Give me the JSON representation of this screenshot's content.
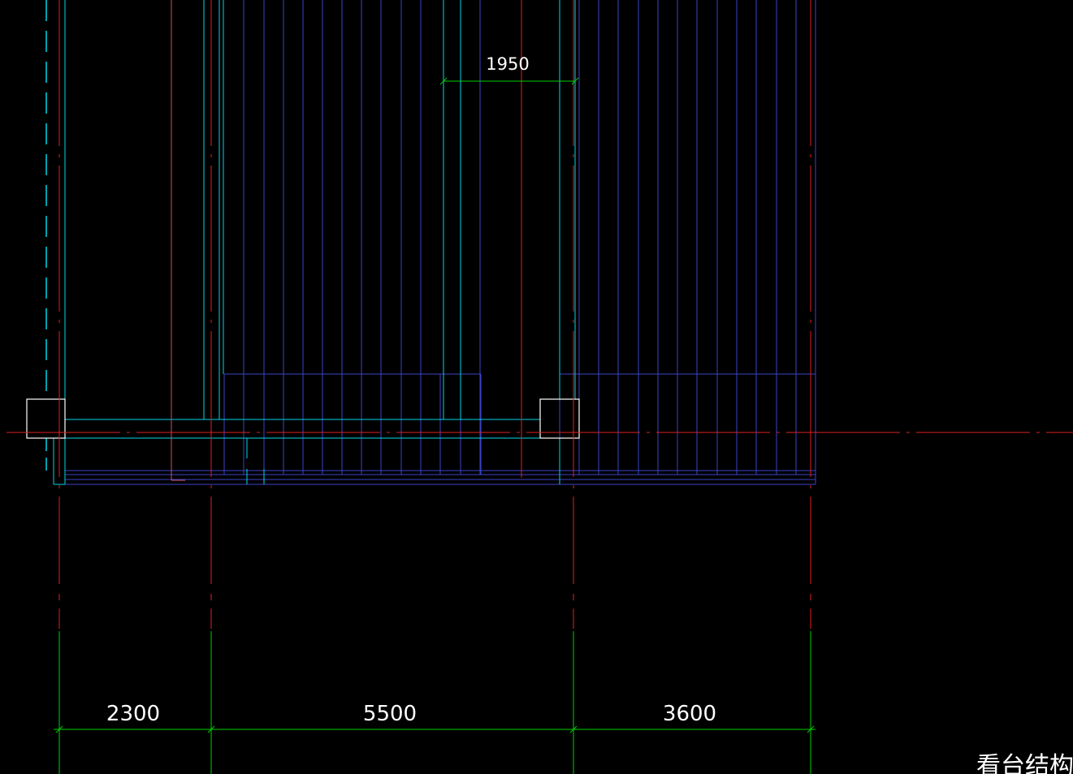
{
  "drawing": {
    "background": "#000000",
    "colors": {
      "axis": "#e02020",
      "dimension": "#00d000",
      "beam": "#00d8e8",
      "stair_lines": "#3a44c8",
      "outline": "#ffffff",
      "pink": "#d05060"
    },
    "top_dimension": {
      "label": "1950"
    },
    "bottom_dimensions": [
      {
        "label": "2300"
      },
      {
        "label": "5500"
      },
      {
        "label": "3600"
      }
    ],
    "title_partial": "看台结构平"
  }
}
